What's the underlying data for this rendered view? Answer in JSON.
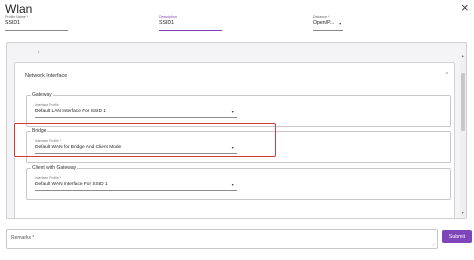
{
  "page": {
    "title": "Wlan"
  },
  "form": {
    "profile_name": {
      "label": "Profile Name *",
      "value": "SSID1"
    },
    "description": {
      "label": "Description",
      "value": "SSID1"
    },
    "distance": {
      "label": "Distance *",
      "value": "Open/P..."
    }
  },
  "panel": {
    "top_marker": "•"
  },
  "network_interface": {
    "title": "Network Interface",
    "groups": [
      {
        "title": "Gateway",
        "select_label": "Interface Profile",
        "select_value": "Default LAN Interface For SSID 1"
      },
      {
        "title": "Bridge",
        "select_label": "Interface Profile *",
        "select_value": "Default WAN for Bridge And Client Mode"
      },
      {
        "title": "Client with Gateway",
        "select_label": "Interface Profile *",
        "select_value": "Default WAN Interface For SSID 1"
      }
    ]
  },
  "remarks": {
    "label": "Remarks *"
  },
  "actions": {
    "submit_label": "Submit"
  },
  "icons": {
    "close": "×",
    "dropdown": "▼",
    "collapse": "^",
    "scroll_up": "▲",
    "scroll_down": "▼",
    "resize": "⟋"
  },
  "colors": {
    "accent": "#7e44b9",
    "highlight": "#d43a3a"
  }
}
